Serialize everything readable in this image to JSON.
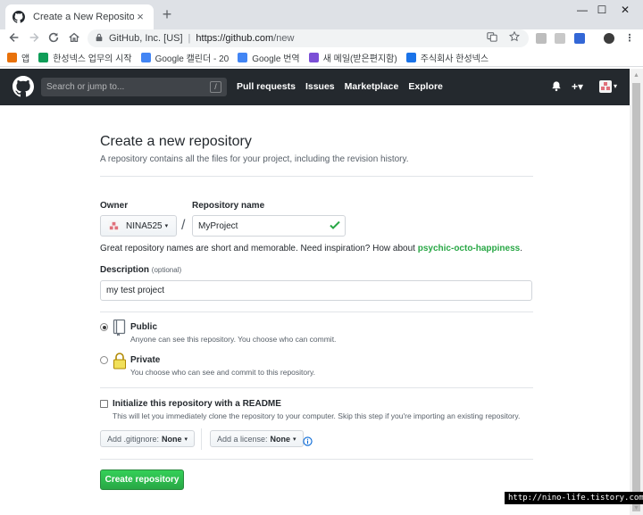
{
  "browser": {
    "tab_title": "Create a New Repository",
    "tab_close": "×",
    "new_tab": "+",
    "window_controls": {
      "minimize": "—",
      "maximize": "☐",
      "close": "✕"
    },
    "org_label": "GitHub, Inc. [US]",
    "url_host": "https://github.com",
    "url_path": "/new",
    "bookmarks": [
      {
        "label": "앱",
        "color": "#e8710a"
      },
      {
        "label": "한성넥스 업무의 시작",
        "color": "#0f9d58"
      },
      {
        "label": "Google 캘린더 - 20",
        "color": "#4285f4"
      },
      {
        "label": "Google 번역",
        "color": "#4285f4"
      },
      {
        "label": "새 메일(받은편지함)",
        "color": "#7b4fd6"
      },
      {
        "label": "주식회사 한성넥스",
        "color": "#1a73e8"
      }
    ]
  },
  "github": {
    "search_placeholder": "Search or jump to...",
    "search_key": "/",
    "nav": [
      "Pull requests",
      "Issues",
      "Marketplace",
      "Explore"
    ],
    "plus": "+▾",
    "avatar_caret": "▾"
  },
  "form": {
    "title": "Create a new repository",
    "subtitle": "A repository contains all the files for your project, including the revision history.",
    "owner_label": "Owner",
    "owner_value": "NINA525",
    "caret": "▾",
    "slash": "/",
    "repo_label": "Repository name",
    "repo_value": "MyProject",
    "hint_prefix": "Great repository names are short and memorable. Need inspiration? How about ",
    "hint_suggestion": "psychic-octo-happiness",
    "hint_suffix": ".",
    "description_label": "Description",
    "description_optional": "(optional)",
    "description_value": "my test project",
    "public_title": "Public",
    "public_note": "Anyone can see this repository. You choose who can commit.",
    "private_title": "Private",
    "private_note": "You choose who can see and commit to this repository.",
    "readme_title": "Initialize this repository with a README",
    "readme_note": "This will let you immediately clone the repository to your computer. Skip this step if you're importing an existing repository.",
    "gitignore_label": "Add .gitignore:",
    "gitignore_value": "None",
    "license_label": "Add a license:",
    "license_value": "None",
    "create_button": "Create repository"
  },
  "watermark": "http://nino-life.tistory.com",
  "colors": {
    "header": "#24292e",
    "primary_green": "#28a745",
    "link_blue": "#0366d6"
  }
}
